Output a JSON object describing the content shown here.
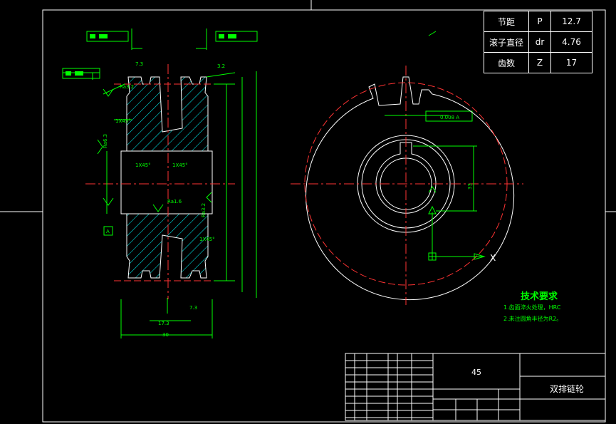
{
  "params": {
    "rows": [
      {
        "label": "节距",
        "symbol": "P",
        "value": "12.7"
      },
      {
        "label": "滚子直径",
        "symbol": "dr",
        "value": "4.76"
      },
      {
        "label": "齿数",
        "symbol": "Z",
        "value": "17"
      }
    ]
  },
  "tech": {
    "title": "技术要求",
    "notes": [
      "1.齿面淬火处理，HRC",
      "2.未注圆角半径为R2。"
    ]
  },
  "titleblock": {
    "material": "45",
    "part_name": "双排链轮"
  },
  "dims": {
    "keyway_width": "7.3",
    "surface_rough_top": "3.2",
    "roughness_a": "Ra3.2",
    "chamfer_1": "1X45°",
    "chamfer_2": "1X45°",
    "chamfer_3": "1X45°",
    "chamfer_4": "1X45°",
    "roughness_b": "Ra6.3",
    "roughness_c": "Ra1.6",
    "roughness_d": "Ra3.2",
    "tooth_dim": "17.3",
    "width_total": "30",
    "bottom_keyway": "7.3",
    "tol_symbol": "0.008 A",
    "key_height": "33",
    "x_label": "X",
    "shaft_label": "A"
  }
}
